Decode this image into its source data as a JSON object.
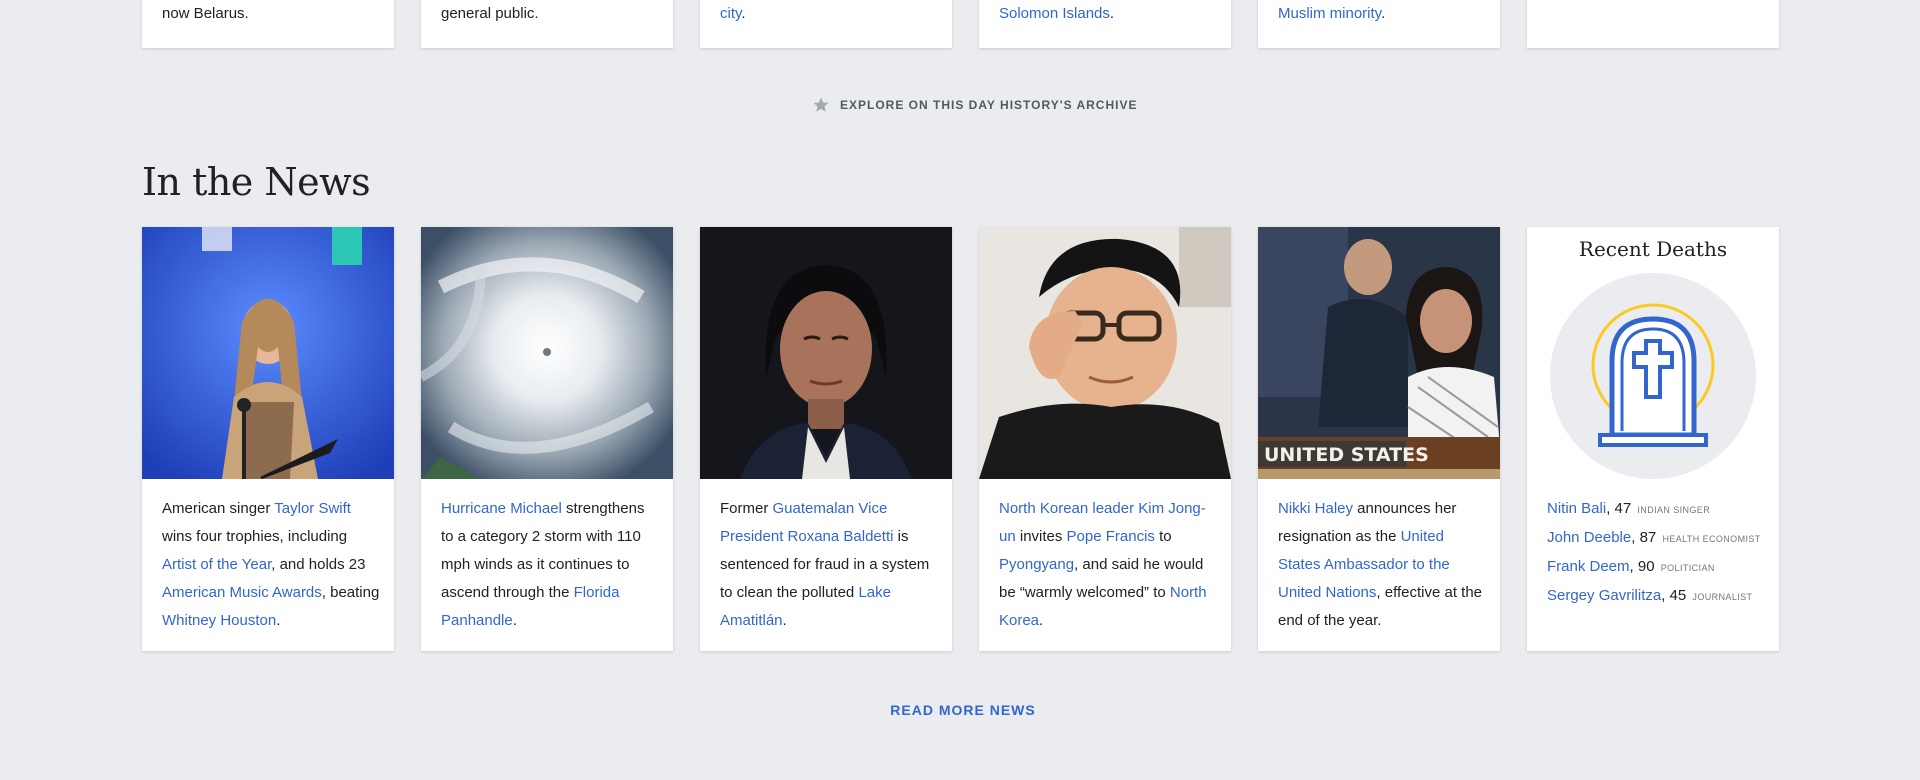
{
  "top_cards": [
    {
      "text": "now Belarus."
    },
    {
      "text": "general public."
    },
    {
      "link": "city",
      "tail": "."
    },
    {
      "link": "Solomon Islands",
      "tail": "."
    },
    {
      "link": "Muslim minority",
      "tail": "."
    },
    {}
  ],
  "explore": {
    "label": "EXPLORE ON THIS DAY HISTORY'S ARCHIVE",
    "icon": "star-icon"
  },
  "section": {
    "title": "In the News"
  },
  "news": [
    {
      "parts": [
        {
          "t": "American singer "
        },
        {
          "l": "Taylor Swift"
        },
        {
          "t": " wins four trophies, including "
        },
        {
          "l": "Artist of the Year"
        },
        {
          "t": ", and holds 23 "
        },
        {
          "l": "American Music Awards"
        },
        {
          "t": ", beating "
        },
        {
          "l": "Whitney Houston"
        },
        {
          "t": "."
        }
      ]
    },
    {
      "parts": [
        {
          "l": "Hurricane Michael"
        },
        {
          "t": " strengthens to a category 2 storm with 110 mph winds as it continues to ascend through the "
        },
        {
          "l": "Florida Panhandle"
        },
        {
          "t": "."
        }
      ]
    },
    {
      "parts": [
        {
          "t": "Former "
        },
        {
          "l": "Guatemalan Vice President Roxana Baldetti"
        },
        {
          "t": " is sentenced for fraud in a system to clean the polluted "
        },
        {
          "l": "Lake Amatitlán"
        },
        {
          "t": "."
        }
      ]
    },
    {
      "parts": [
        {
          "l": "North Korean leader Kim Jong-un"
        },
        {
          "t": " invites "
        },
        {
          "l": "Pope Francis"
        },
        {
          "t": " to "
        },
        {
          "l": "Pyongyang"
        },
        {
          "t": ", and said he would be “warmly welcomed” to "
        },
        {
          "l": "North Korea"
        },
        {
          "t": "."
        }
      ]
    },
    {
      "parts": [
        {
          "l": "Nikki Haley"
        },
        {
          "t": " announces her resignation as the "
        },
        {
          "l": "United States Ambassador to the United Nations"
        },
        {
          "t": ", effective at the end of the year."
        }
      ]
    }
  ],
  "nameplate": "UNITED STATES",
  "recent_deaths": {
    "title": "Recent Deaths",
    "icon": "tombstone-icon",
    "items": [
      {
        "name": "Nitin Bali",
        "age": ", 47",
        "role": "INDIAN SINGER"
      },
      {
        "name": "John Deeble",
        "age": ", 87",
        "role": "HEALTH ECONOMIST"
      },
      {
        "name": "Frank Deem",
        "age": ", 90",
        "role": "POLITICIAN"
      },
      {
        "name": "Sergey Gavrilitza",
        "age": ", 45",
        "role": "JOURNALIST"
      }
    ]
  },
  "read_more": "READ MORE NEWS",
  "colors": {
    "link": "#3366cc",
    "background": "#eaecf0",
    "accent": "#fcc923"
  }
}
